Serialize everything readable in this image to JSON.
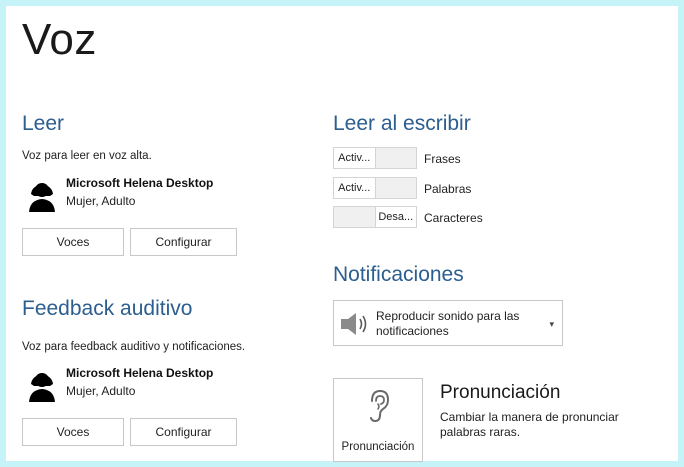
{
  "page": {
    "title": "Voz"
  },
  "read": {
    "title": "Leer",
    "description": "Voz para leer en voz alta.",
    "voice_name": "Microsoft Helena Desktop",
    "voice_meta": "Mujer, Adulto",
    "voices_button": "Voces",
    "configure_button": "Configurar"
  },
  "feedback": {
    "title": "Feedback auditivo",
    "description": "Voz para feedback auditivo y notificaciones.",
    "voice_name": "Microsoft Helena Desktop",
    "voice_meta": "Mujer, Adulto",
    "voices_button": "Voces",
    "configure_button": "Configurar"
  },
  "typing": {
    "title": "Leer al escribir",
    "toggles": [
      {
        "on_label": "Activ...",
        "off_label": "",
        "label": "Frases",
        "state": "on"
      },
      {
        "on_label": "Activ...",
        "off_label": "",
        "label": "Palabras",
        "state": "on"
      },
      {
        "on_label": "",
        "off_label": "Desa...",
        "label": "Caracteres",
        "state": "off"
      }
    ]
  },
  "notifications": {
    "title": "Notificaciones",
    "dropdown_value": "Reproducir sonido para las notificaciones",
    "icon": "speaker-icon"
  },
  "pronunciation": {
    "tile_label": "Pronunciación",
    "title": "Pronunciación",
    "description": "Cambiar la manera de pronunciar palabras raras.",
    "icon": "ear-icon"
  },
  "colors": {
    "accent": "#2c5e8f",
    "background": "#c6f3f7"
  }
}
